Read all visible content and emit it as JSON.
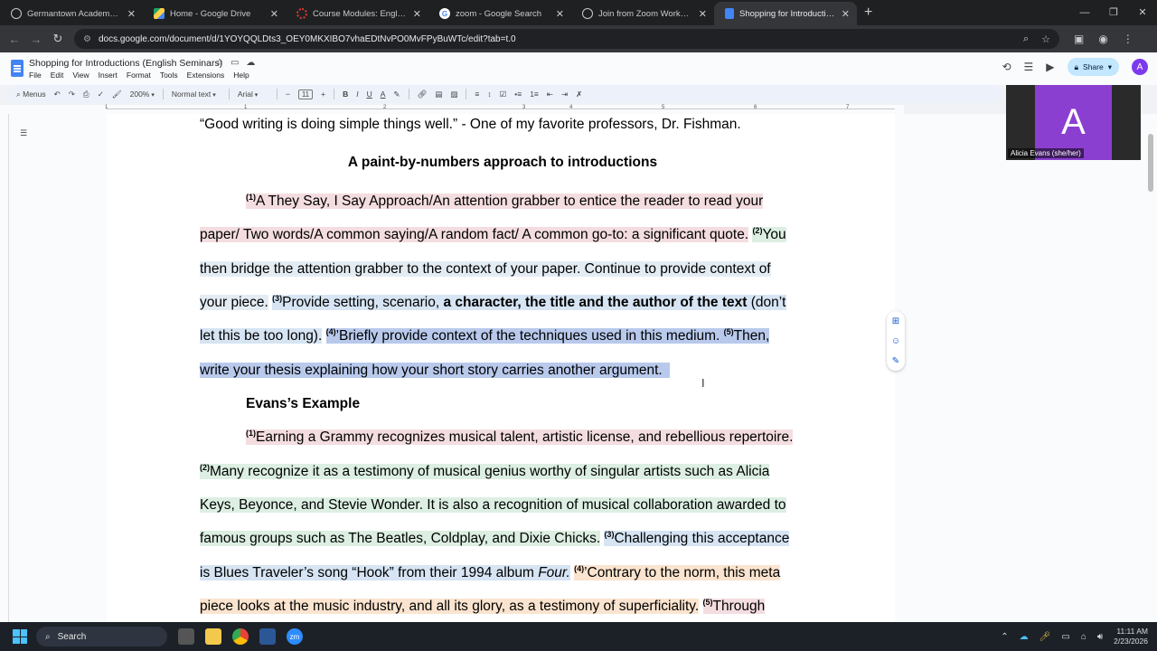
{
  "browser": {
    "tabs": [
      {
        "title": "Germantown Academy - Emplo",
        "icon": "ga-icon",
        "color": "#4a90d9",
        "active": false
      },
      {
        "title": "Home - Google Drive",
        "icon": "drive-icon",
        "color": "#1fa463",
        "active": false
      },
      {
        "title": "Course Modules: English Semin",
        "icon": "canvas-icon",
        "color": "#e03c31",
        "active": false
      },
      {
        "title": "zoom - Google Search",
        "icon": "google-icon",
        "color": "#ffffff",
        "active": false
      },
      {
        "title": "Join from Zoom Workplace app",
        "icon": "globe-icon",
        "color": "#c8cacd",
        "active": false
      },
      {
        "title": "Shopping for Introductions (En",
        "icon": "docs-icon",
        "color": "#4285f4",
        "active": true
      }
    ],
    "url": "docs.google.com/document/d/1YOYQQLDts3_OEY0MKXIBO7vhaEDtNvPO0MvFPyBuWTc/edit?tab=t.0"
  },
  "docs": {
    "title": "Shopping for Introductions (English Seminars)",
    "menu": [
      "File",
      "Edit",
      "View",
      "Insert",
      "Format",
      "Tools",
      "Extensions",
      "Help"
    ],
    "share_label": "Share",
    "avatar_letter": "A",
    "toolbar": {
      "menus_label": "Menus",
      "zoom": "200%",
      "style": "Normal text",
      "font": "Arial",
      "font_size": "11"
    },
    "ruler_numbers": [
      "1",
      "1",
      "2",
      "3",
      "4",
      "5",
      "6",
      "7"
    ]
  },
  "document": {
    "quote_line": "“Good writing is doing simple things well.” - One of my favorite professors, Dr. Fishman.",
    "heading1": "A paint-by-numbers approach to introductions",
    "p1": {
      "l1_sup": "(1)",
      "l1": "A They Say, I Say Approach/An attention grabber to entice the reader to read your",
      "l2": "paper/ Two words/A common saying/A random fact/ A common go-to: a significant quote.",
      "l2_sup": "(2)",
      "l2_tail": "You",
      "l3": "then bridge the attention grabber to the context of your paper. Continue to provide context of",
      "l4a": "your piece.",
      "l4_sup": "(3)",
      "l4b": "Provide setting, scenario,",
      "l4_bold": "a character, the title and the author of the text",
      "l4c": "(don’t",
      "l5a": "let this be too long).",
      "l5_sup": "(4)",
      "l5b": "’Briefly provide context of the techniques used in this medium.",
      "l5_sup2": "(5)",
      "l5c": "Then,",
      "l6": "write your thesis explaining how your short story carries another argument."
    },
    "heading2": "Evans’s Example",
    "p2": {
      "l1_sup": "(1)",
      "l1": "Earning a Grammy recognizes musical talent, artistic license, and rebellious repertoire.",
      "l2_sup": "(2)",
      "l2": "Many recognize it as a testimony of musical genius worthy of singular artists such as Alicia",
      "l3": "Keys, Beyonce, and Stevie Wonder. It is also a recognition of musical collaboration awarded to",
      "l4": "famous groups such as The Beatles, Coldplay, and Dixie Chicks.",
      "l4_sup": "(3)",
      "l4b": "Challenging this acceptance",
      "l5a": "is Blues Traveler’s song “Hook” from their 1994 album",
      "l5_italic": "Four.",
      "l5_sup": "(4)",
      "l5b": "’Contrary to the norm, this meta",
      "l6a": "piece looks at the music industry, and all its glory, as a testimony of superficiality.",
      "l6_sup": "(5)",
      "l6b": "Through"
    }
  },
  "zoom": {
    "participant_letter": "A",
    "participant_name": "Alicia Evans (she/her)"
  },
  "taskbar": {
    "search_label": "Search",
    "time": "11:11 AM",
    "date": "2/23/2026"
  }
}
